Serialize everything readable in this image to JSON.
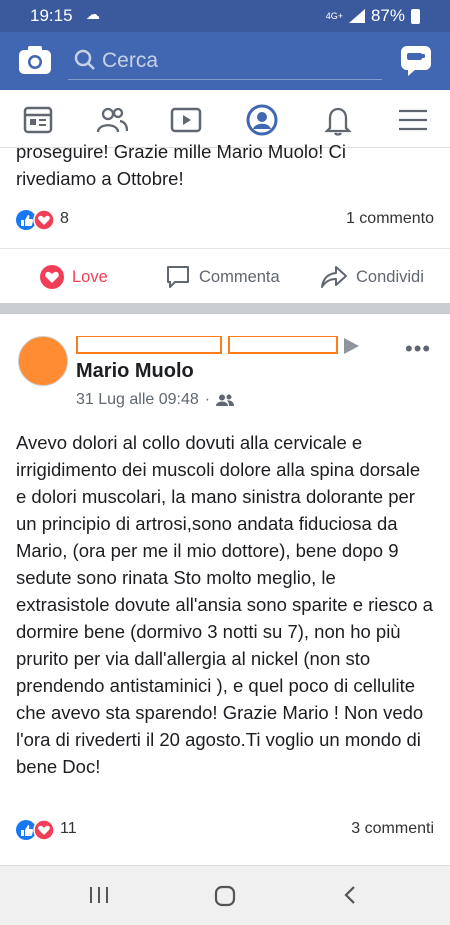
{
  "status": {
    "time": "19:15",
    "network": "4G+",
    "battery": "87%"
  },
  "search": {
    "placeholder": "Cerca"
  },
  "post1": {
    "text_line1": "proseguire! Grazie mille Mario Muolo! Ci",
    "text_line2": "rivediamo a Ottobre!",
    "reaction_count": "8",
    "comments": "1 commento",
    "actions": {
      "love": "Love",
      "comment": "Commenta",
      "share": "Condividi"
    }
  },
  "post2": {
    "author": "Mario Muolo",
    "date": "31 Lug alle 09:48",
    "text": "Avevo dolori al collo dovuti alla cervicale e irrigidimento dei muscoli dolore alla spina dorsale e dolori muscolari, la mano sinistra dolorante per un principio di artrosi,sono andata fiduciosa da Mario, (ora per me il mio dottore), bene dopo 9 sedute sono rinata Sto molto meglio, le extrasistole dovute all'ansia sono sparite e riesco a dormire bene (dormivo 3 notti su 7), non ho più prurito per via dall'allergia al nickel (non sto prendendo antistaminici ), e quel poco di cellulite che avevo sta sparendo! Grazie Mario ! Non vedo l'ora di rivederti il 20 agosto.Ti voglio un mondo di bene Doc!",
    "reaction_count": "11",
    "comments": "3 commenti"
  },
  "colors": {
    "brand": "#4267b2",
    "love": "#f33e58",
    "like": "#1877f2"
  }
}
